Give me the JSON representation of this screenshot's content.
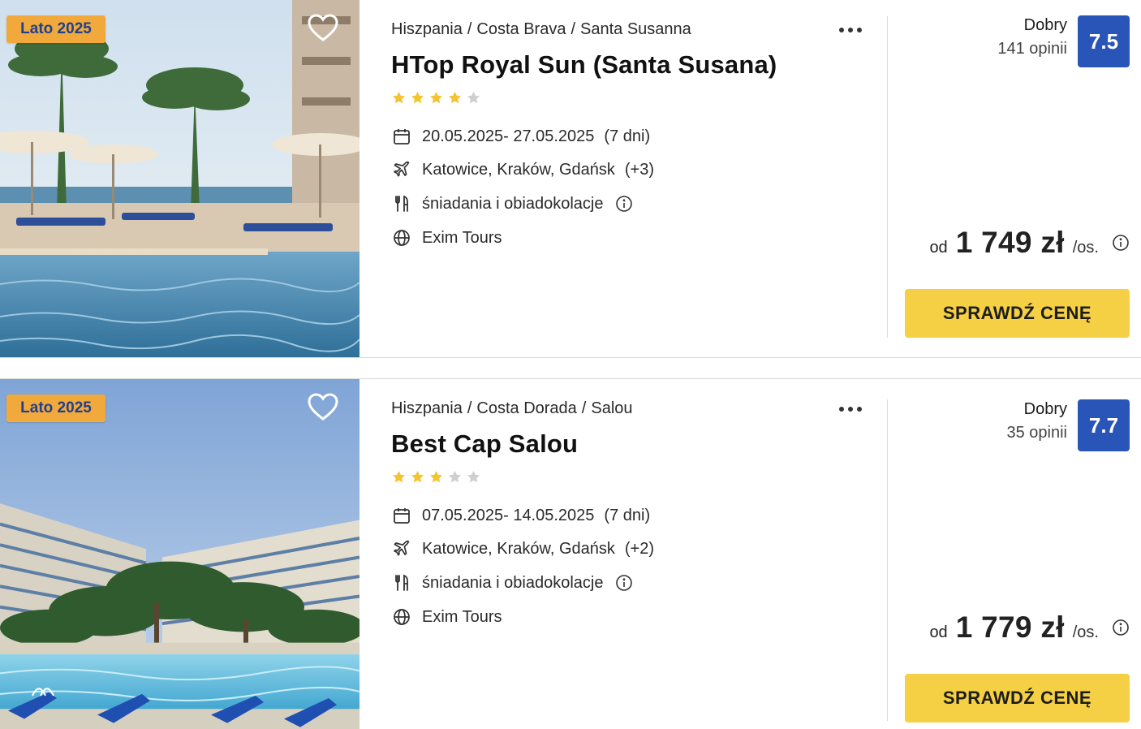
{
  "offers": [
    {
      "badge": "Lato 2025",
      "location": [
        "Hiszpania",
        "Costa Brava",
        "Santa Susanna"
      ],
      "name": "HTop Royal Sun (Santa Susana)",
      "stars": 4,
      "dates": "20.05.2025- 27.05.2025",
      "duration": "(7 dni)",
      "airports": "Katowice, Kraków, Gdańsk",
      "airports_more": "(+3)",
      "board": "śniadania i obiadokolacje",
      "operator": "Exim Tours",
      "rating_word": "Dobry",
      "rating_count": "141 opinii",
      "score": "7.5",
      "price_from": "od",
      "price": "1 749 zł",
      "price_per": "/os.",
      "cta": "SPRAWDŹ CENĘ"
    },
    {
      "badge": "Lato 2025",
      "location": [
        "Hiszpania",
        "Costa Dorada",
        "Salou"
      ],
      "name": "Best Cap Salou",
      "stars": 3,
      "dates": "07.05.2025- 14.05.2025",
      "duration": "(7 dni)",
      "airports": "Katowice, Kraków, Gdańsk",
      "airports_more": "(+2)",
      "board": "śniadania i obiadokolacje",
      "operator": "Exim Tours",
      "rating_word": "Dobry",
      "rating_count": "35 opinii",
      "score": "7.7",
      "price_from": "od",
      "price": "1 779 zł",
      "price_per": "/os.",
      "cta": "SPRAWDŹ CENĘ"
    }
  ],
  "max_stars": 5,
  "icons": {
    "favorite": "heart-icon",
    "more": "more-options-icon",
    "dates": "calendar-icon",
    "airports": "airplane-icon",
    "board": "cutlery-icon",
    "operator": "globe-icon",
    "info": "info-icon"
  },
  "colors": {
    "badge_bg": "#f2a93b",
    "badge_text": "#1f3f8f",
    "score_bg": "#2a55b8",
    "cta_bg": "#f5d044",
    "star_on": "#f4c430",
    "star_off": "#cfcfcf"
  }
}
